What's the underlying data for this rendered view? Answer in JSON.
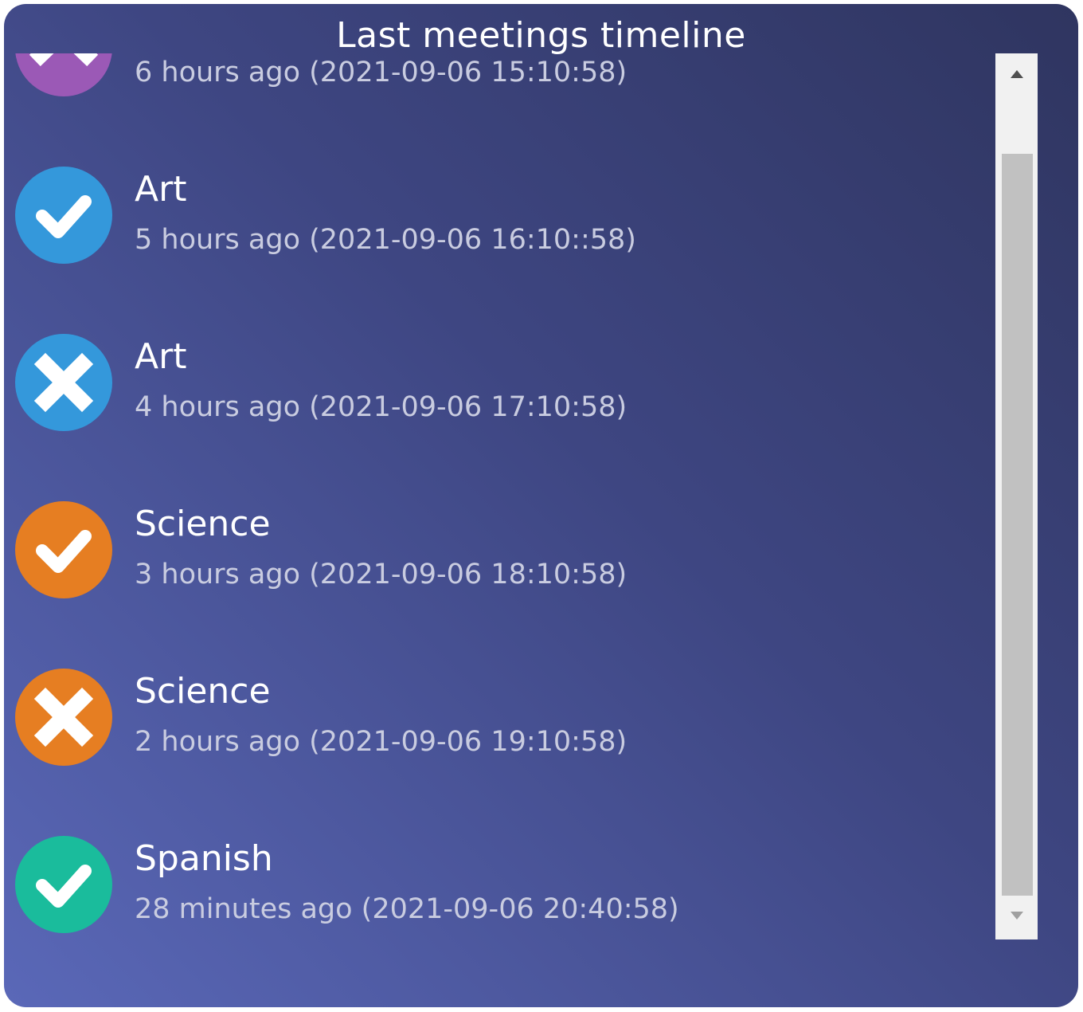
{
  "title": "Last meetings timeline",
  "colors": {
    "purple": "#9b59b6",
    "blue": "#3498db",
    "orange": "#e67e22",
    "green": "#1abc9c"
  },
  "items": [
    {
      "title": "",
      "time": "6 hours ago (2021-09-06 15:10:58)",
      "color": "#9b59b6",
      "icon": "chevron-up-icon"
    },
    {
      "title": "Art",
      "time": "5 hours ago (2021-09-06 16:10::58)",
      "color": "#3498db",
      "icon": "check-icon"
    },
    {
      "title": "Art",
      "time": "4 hours ago (2021-09-06 17:10:58)",
      "color": "#3498db",
      "icon": "cross-icon"
    },
    {
      "title": "Science",
      "time": "3 hours ago (2021-09-06 18:10:58)",
      "color": "#e67e22",
      "icon": "check-icon"
    },
    {
      "title": "Science",
      "time": "2 hours ago (2021-09-06 19:10:58)",
      "color": "#e67e22",
      "icon": "cross-icon"
    },
    {
      "title": "Spanish",
      "time": "28 minutes ago (2021-09-06 20:40:58)",
      "color": "#1abc9c",
      "icon": "check-icon"
    }
  ],
  "scrollbar": {
    "up_icon": "scroll-up-arrow-icon",
    "down_icon": "scroll-down-arrow-icon"
  }
}
